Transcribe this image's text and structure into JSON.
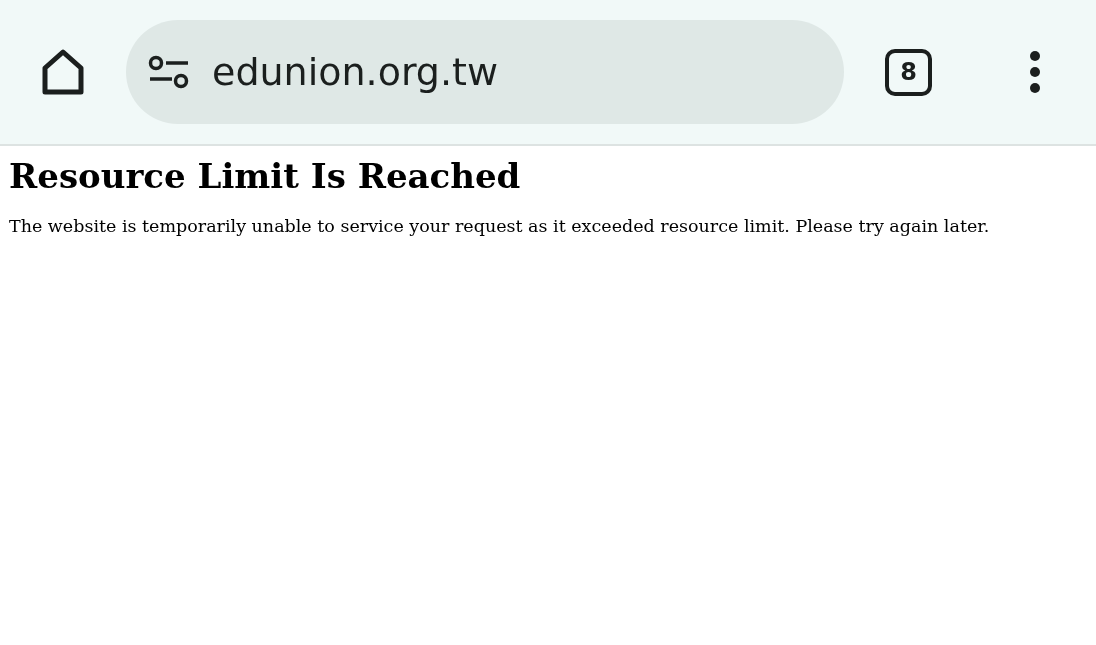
{
  "toolbar": {
    "url": "edunion.org.tw",
    "tab_count": "8"
  },
  "page": {
    "heading": "Resource Limit Is Reached",
    "message": "The website is temporarily unable to service your request as it exceeded resource limit. Please try again later."
  }
}
